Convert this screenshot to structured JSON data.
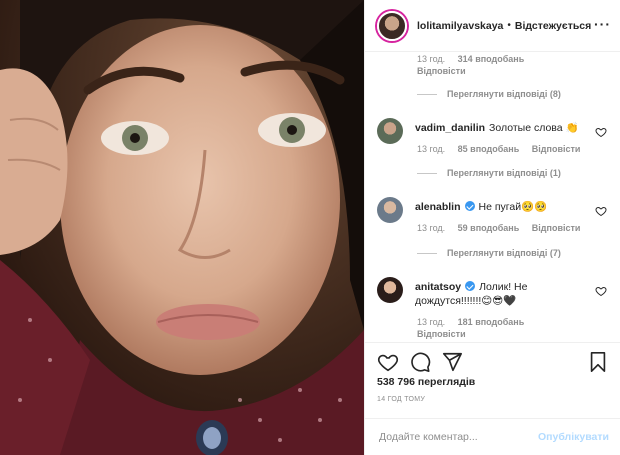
{
  "post": {
    "username": "lolitamilyavskaya",
    "separator": "•",
    "follow_label": "Відстежується",
    "more_label": "···"
  },
  "comments": {
    "top_meta": {
      "time": "13 год.",
      "likes": "314 вподобань",
      "reply": "Відповісти"
    },
    "top_view_replies": "Переглянути відповіді (8)",
    "items": [
      {
        "username": "vadim_danilin",
        "verified": false,
        "text": "Золотые слова 👏",
        "time": "13 год.",
        "likes": "85 вподобань",
        "reply": "Відповісти",
        "view_replies": "Переглянути відповіді (1)"
      },
      {
        "username": "alenablin",
        "verified": true,
        "text": "Не пугай🥺🥺",
        "time": "13 год.",
        "likes": "59 вподобань",
        "reply": "Відповісти",
        "view_replies": "Переглянути відповіді (7)"
      },
      {
        "username": "anitatsoy",
        "verified": true,
        "text": "Лолик! Не дождутся!!!!!!!😊😎🖤",
        "time": "13 год.",
        "likes": "181 вподобань",
        "reply": "Відповісти"
      }
    ]
  },
  "stats": {
    "views": "538 796 переглядів",
    "time_ago": "14 ГОД ТОМУ"
  },
  "composer": {
    "placeholder": "Додайте коментар...",
    "post_label": "Опублікувати"
  },
  "icons": {
    "like": "heart-icon",
    "comment": "comment-icon",
    "share": "share-icon",
    "save": "bookmark-icon"
  },
  "colors": {
    "link_blue": "#3897f0",
    "post_disabled": "#b3dbff",
    "muted": "#8e8e8e"
  }
}
